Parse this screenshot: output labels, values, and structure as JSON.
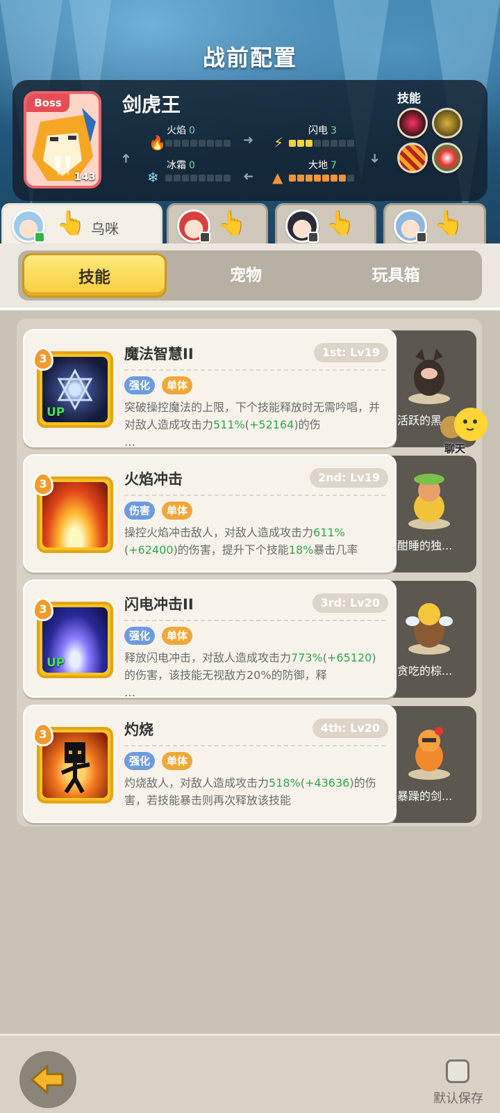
{
  "header": {
    "title": "战前配置"
  },
  "boss": {
    "tag": "Boss",
    "name": "剑虎王",
    "level": "143",
    "elements": {
      "fire": {
        "label": "火焰",
        "value": "0"
      },
      "lightning": {
        "label": "闪电",
        "value": "3"
      },
      "frost": {
        "label": "冰霜",
        "value": "0"
      },
      "earth": {
        "label": "大地",
        "value": "7"
      }
    },
    "skills_label": "技能"
  },
  "heroes": [
    {
      "name": "乌咪",
      "active": true
    },
    {
      "name": "",
      "active": false
    },
    {
      "name": "",
      "active": false
    },
    {
      "name": "",
      "active": false
    }
  ],
  "category_tabs": [
    "技能",
    "宠物",
    "玩具箱"
  ],
  "skills": [
    {
      "level": "3",
      "name": "魔法智慧II",
      "rank": "1st: Lv19",
      "up": "UP",
      "tags": [
        "强化",
        "单体"
      ],
      "desc_a": "突破操控魔法的上限，下个技能释放时无需吟唱，并对敌人造成攻击力",
      "desc_pct": "511%",
      "desc_b": "(",
      "desc_bonus": "+52164",
      "desc_c": ")的伤",
      "desc_more": "…"
    },
    {
      "level": "3",
      "name": "火焰冲击",
      "rank": "2nd: Lv19",
      "up": "",
      "tags": [
        "伤害",
        "单体"
      ],
      "desc_a": "操控火焰冲击敌人，对敌人造成攻击力",
      "desc_pct": "611%",
      "desc_b": "(",
      "desc_bonus": "+62400",
      "desc_c": ")的伤害，提升下个技能",
      "desc_pct2": "18%",
      "desc_d": "暴击几率"
    },
    {
      "level": "3",
      "name": "闪电冲击II",
      "rank": "3rd: Lv20",
      "up": "UP",
      "tags": [
        "强化",
        "单体"
      ],
      "desc_a": "释放闪电冲击，对敌人造成攻击力",
      "desc_pct": "773%",
      "desc_b": "(",
      "desc_bonus": "+65120",
      "desc_c": ")的伤害，该技能无视敌方20%的防御，释",
      "desc_more": "…"
    },
    {
      "level": "3",
      "name": "灼烧",
      "rank": "4th: Lv20",
      "up": "",
      "tags": [
        "强化",
        "单体"
      ],
      "desc_a": "灼烧敌人，对敌人造成攻击力",
      "desc_pct": "518%",
      "desc_b": "(",
      "desc_bonus": "+43636",
      "desc_c": ")的伤害，若技能暴击则再次释放该技能"
    }
  ],
  "pets": [
    {
      "name": "活跃的黑"
    },
    {
      "name": "酣睡的独..."
    },
    {
      "name": "贪吃的棕..."
    },
    {
      "name": "暴躁的剑..."
    }
  ],
  "chat": {
    "label": "聊天"
  },
  "footer": {
    "save_label": "默认保存"
  },
  "colors": {
    "accent_yellow": "#f7cd3c",
    "highlight_green": "#2ea84a",
    "tag_blue": "#6e9be0",
    "tag_orange": "#f0a83a",
    "boss_red": "#e64d55"
  }
}
